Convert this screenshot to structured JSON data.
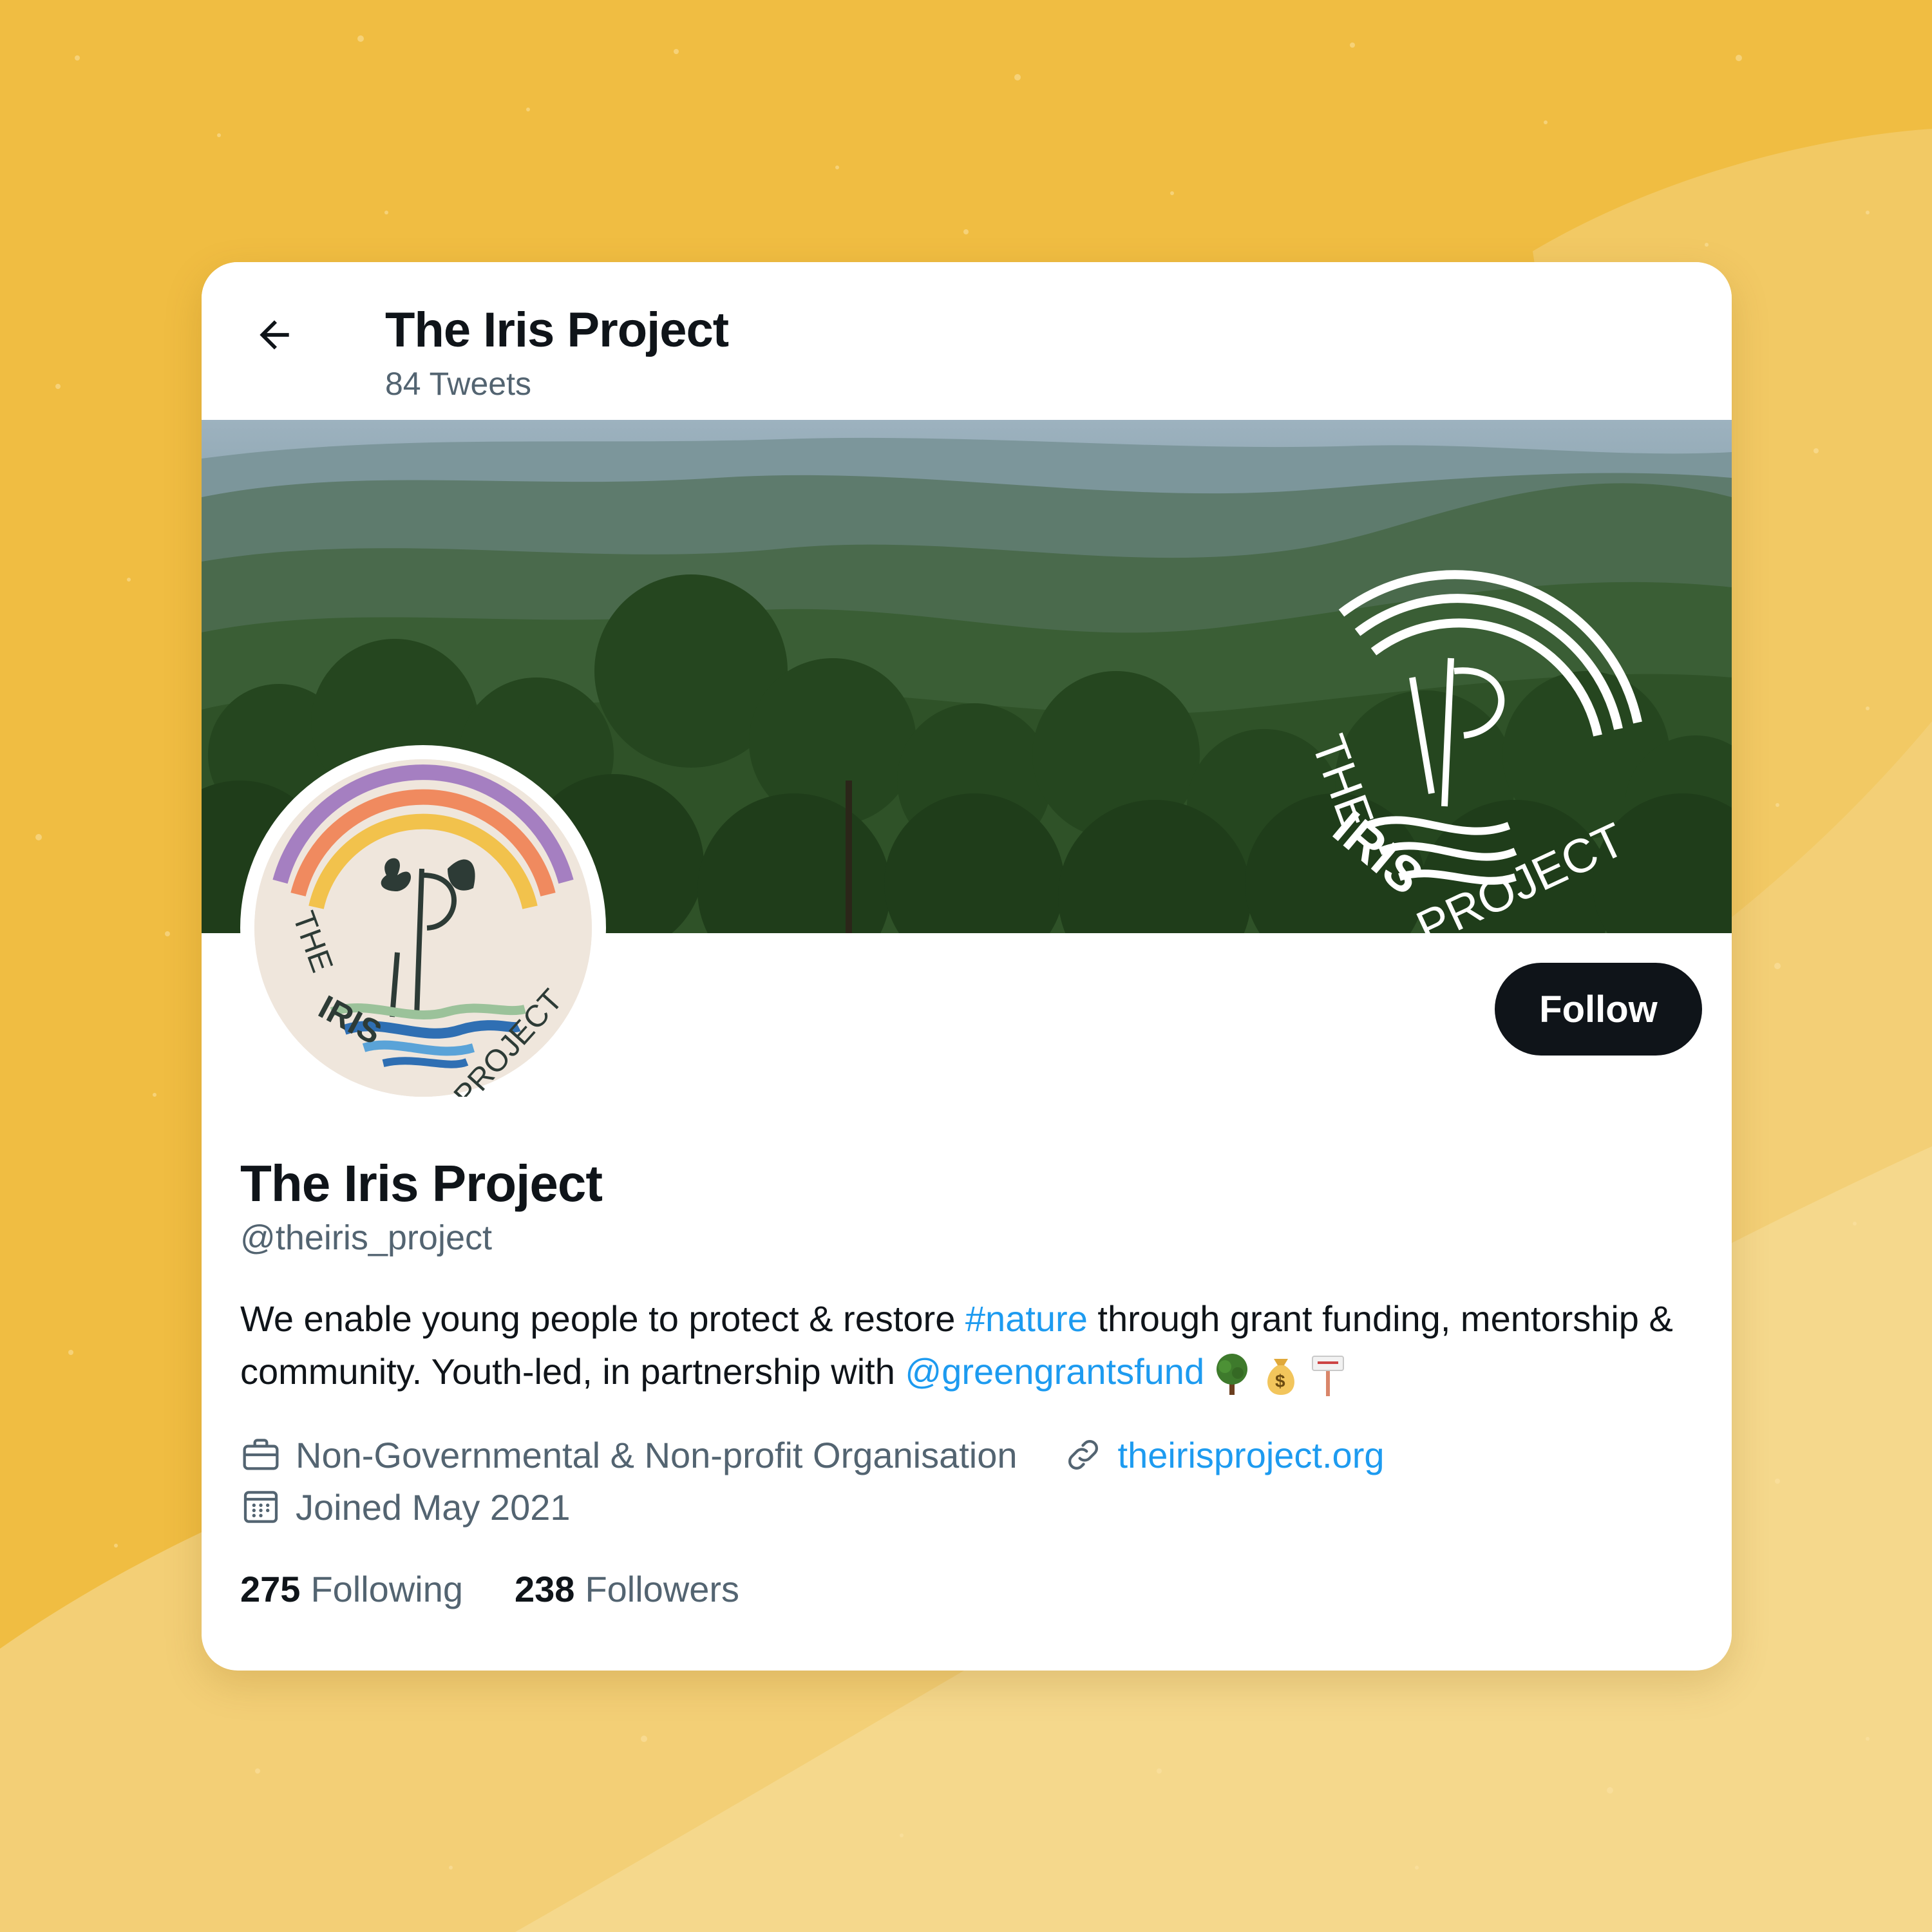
{
  "header": {
    "title": "The Iris Project",
    "tweet_count": "84 Tweets"
  },
  "banner": {
    "logo_text_top": "THE",
    "logo_text_brand": "IRIS",
    "logo_text_bottom": "PROJECT"
  },
  "avatar": {
    "logo_text_top": "THE",
    "logo_text_brand": "IRIS",
    "logo_text_bottom": "PROJECT"
  },
  "profile": {
    "name": "The Iris Project",
    "handle": "@theiris_project",
    "follow_label": "Follow",
    "bio_part1": "We enable young people to protect & restore ",
    "bio_hashtag": "#nature",
    "bio_part2": " through grant funding, mentorship & community. Youth-led, in partnership with ",
    "bio_mention": "@greengrantsfund",
    "category": "Non-Governmental & Non-profit Organisation",
    "website": "theirisproject.org",
    "joined": "Joined May 2021"
  },
  "stats": {
    "following_count": "275",
    "following_label": "Following",
    "followers_count": "238",
    "followers_label": "Followers"
  },
  "icons": {
    "back": "arrow-left-icon",
    "category": "briefcase-icon",
    "website": "link-icon",
    "joined": "calendar-icon",
    "bio_emojis": [
      "tree-icon",
      "money-bag-icon",
      "signpost-icon"
    ]
  },
  "colors": {
    "background": "#f0bd42",
    "accent_link": "#1d9bf0",
    "text_primary": "#0f1419",
    "text_secondary": "#536471",
    "follow_button": "#0f1419"
  }
}
